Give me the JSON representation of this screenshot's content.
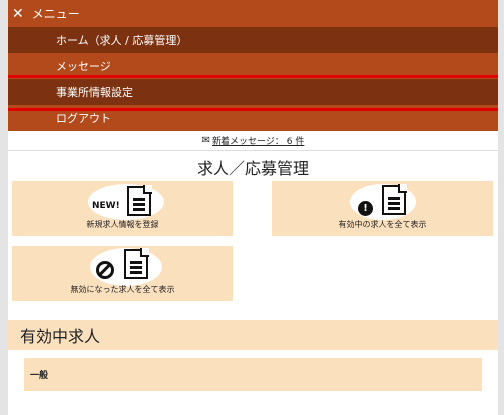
{
  "menu": {
    "close_icon": "close-icon",
    "title": "メニュー",
    "items": [
      {
        "label": "ホーム（求人 / 応募管理）"
      },
      {
        "label": "メッセージ"
      },
      {
        "label": "事業所情報設定"
      },
      {
        "label": "ログアウト"
      }
    ]
  },
  "messages": {
    "icon": "mail-icon",
    "link_text": "新着メッセージ：",
    "count": "6 件"
  },
  "page_title": "求人／応募管理",
  "cards": [
    {
      "label": "新規求人情報を登録",
      "badge": "NEW!",
      "icon": "document-icon"
    },
    {
      "label": "有効中の求人を全て表示",
      "icon": "document-icon",
      "badge_icon": "exclamation-icon"
    },
    {
      "label": "無効になった求人を全て表示",
      "icon": "document-icon",
      "badge_icon": "prohibited-icon"
    }
  ],
  "active_section": {
    "title": "有効中求人",
    "group_label": "一般"
  },
  "colors": {
    "menu_bg": "#b24a1c",
    "menu_dark": "#7c3211",
    "card_bg": "#fbe0bd",
    "highlight": "#e00000"
  }
}
